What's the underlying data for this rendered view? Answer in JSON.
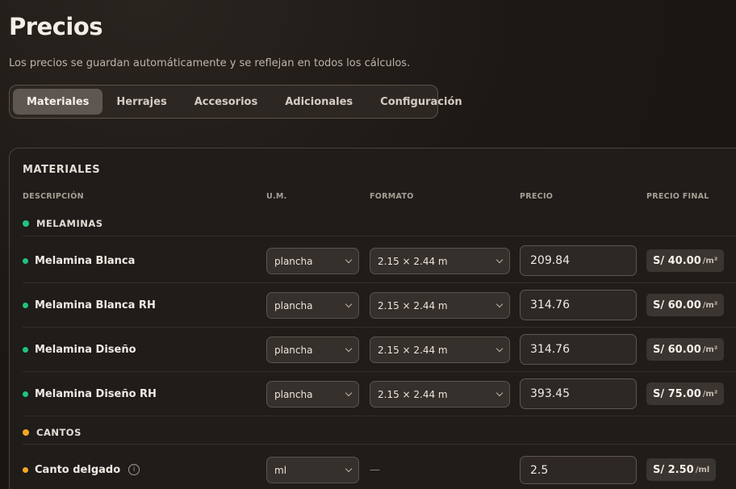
{
  "header": {
    "title": "Precios",
    "subtitle": "Los precios se guardan automáticamente y se reflejan en todos los cálculos."
  },
  "tabs": [
    {
      "label": "Materiales",
      "active": true
    },
    {
      "label": "Herrajes",
      "active": false
    },
    {
      "label": "Accesorios",
      "active": false
    },
    {
      "label": "Adicionales",
      "active": false
    },
    {
      "label": "Configuración",
      "active": false
    }
  ],
  "panel": {
    "title": "MATERIALES",
    "columns": {
      "description": "DESCRIPCIÓN",
      "um": "U.M.",
      "format": "FORMATO",
      "price": "PRECIO",
      "final_price": "PRECIO FINAL"
    }
  },
  "groups": {
    "melaminas": {
      "label": "MELAMINAS",
      "color": "#22c37d",
      "rows": [
        {
          "name": "Melamina Blanca",
          "um": "plancha",
          "format": "2.15 × 2.44 m",
          "price": "209.84",
          "final": "S/ 40.00",
          "final_unit": "/m²"
        },
        {
          "name": "Melamina Blanca RH",
          "um": "plancha",
          "format": "2.15 × 2.44 m",
          "price": "314.76",
          "final": "S/ 60.00",
          "final_unit": "/m²"
        },
        {
          "name": "Melamina Diseño",
          "um": "plancha",
          "format": "2.15 × 2.44 m",
          "price": "314.76",
          "final": "S/ 60.00",
          "final_unit": "/m²"
        },
        {
          "name": "Melamina Diseño RH",
          "um": "plancha",
          "format": "2.15 × 2.44 m",
          "price": "393.45",
          "final": "S/ 75.00",
          "final_unit": "/m²"
        }
      ]
    },
    "cantos": {
      "label": "CANTOS",
      "color": "#f5a623",
      "rows": [
        {
          "name": "Canto delgado",
          "info_icon": "info-icon",
          "um": "ml",
          "format": "—",
          "price": "2.5",
          "final": "S/ 2.50",
          "final_unit": "/ml"
        }
      ]
    }
  }
}
